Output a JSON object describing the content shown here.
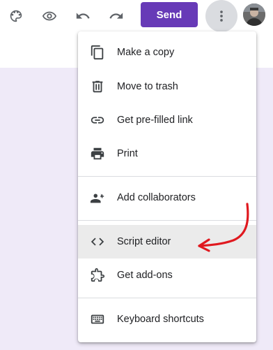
{
  "toolbar": {
    "send_label": "Send",
    "icons": [
      "palette-icon",
      "eye-icon",
      "undo-icon",
      "redo-icon",
      "more-vert-icon"
    ]
  },
  "menu": {
    "items": [
      {
        "label": "Make a copy",
        "icon": "copy-icon"
      },
      {
        "label": "Move to trash",
        "icon": "trash-icon"
      },
      {
        "label": "Get pre-filled link",
        "icon": "link-icon"
      },
      {
        "label": "Print",
        "icon": "print-icon"
      },
      {
        "label": "Add collaborators",
        "icon": "add-collaborators-icon"
      },
      {
        "label": "Script editor",
        "icon": "code-icon",
        "highlighted": true
      },
      {
        "label": "Get add-ons",
        "icon": "puzzle-icon"
      },
      {
        "label": "Keyboard shortcuts",
        "icon": "keyboard-icon"
      }
    ]
  },
  "colors": {
    "brand": "#673ab7",
    "page_background": "#efeaf8",
    "annotation": "#e0191f"
  }
}
